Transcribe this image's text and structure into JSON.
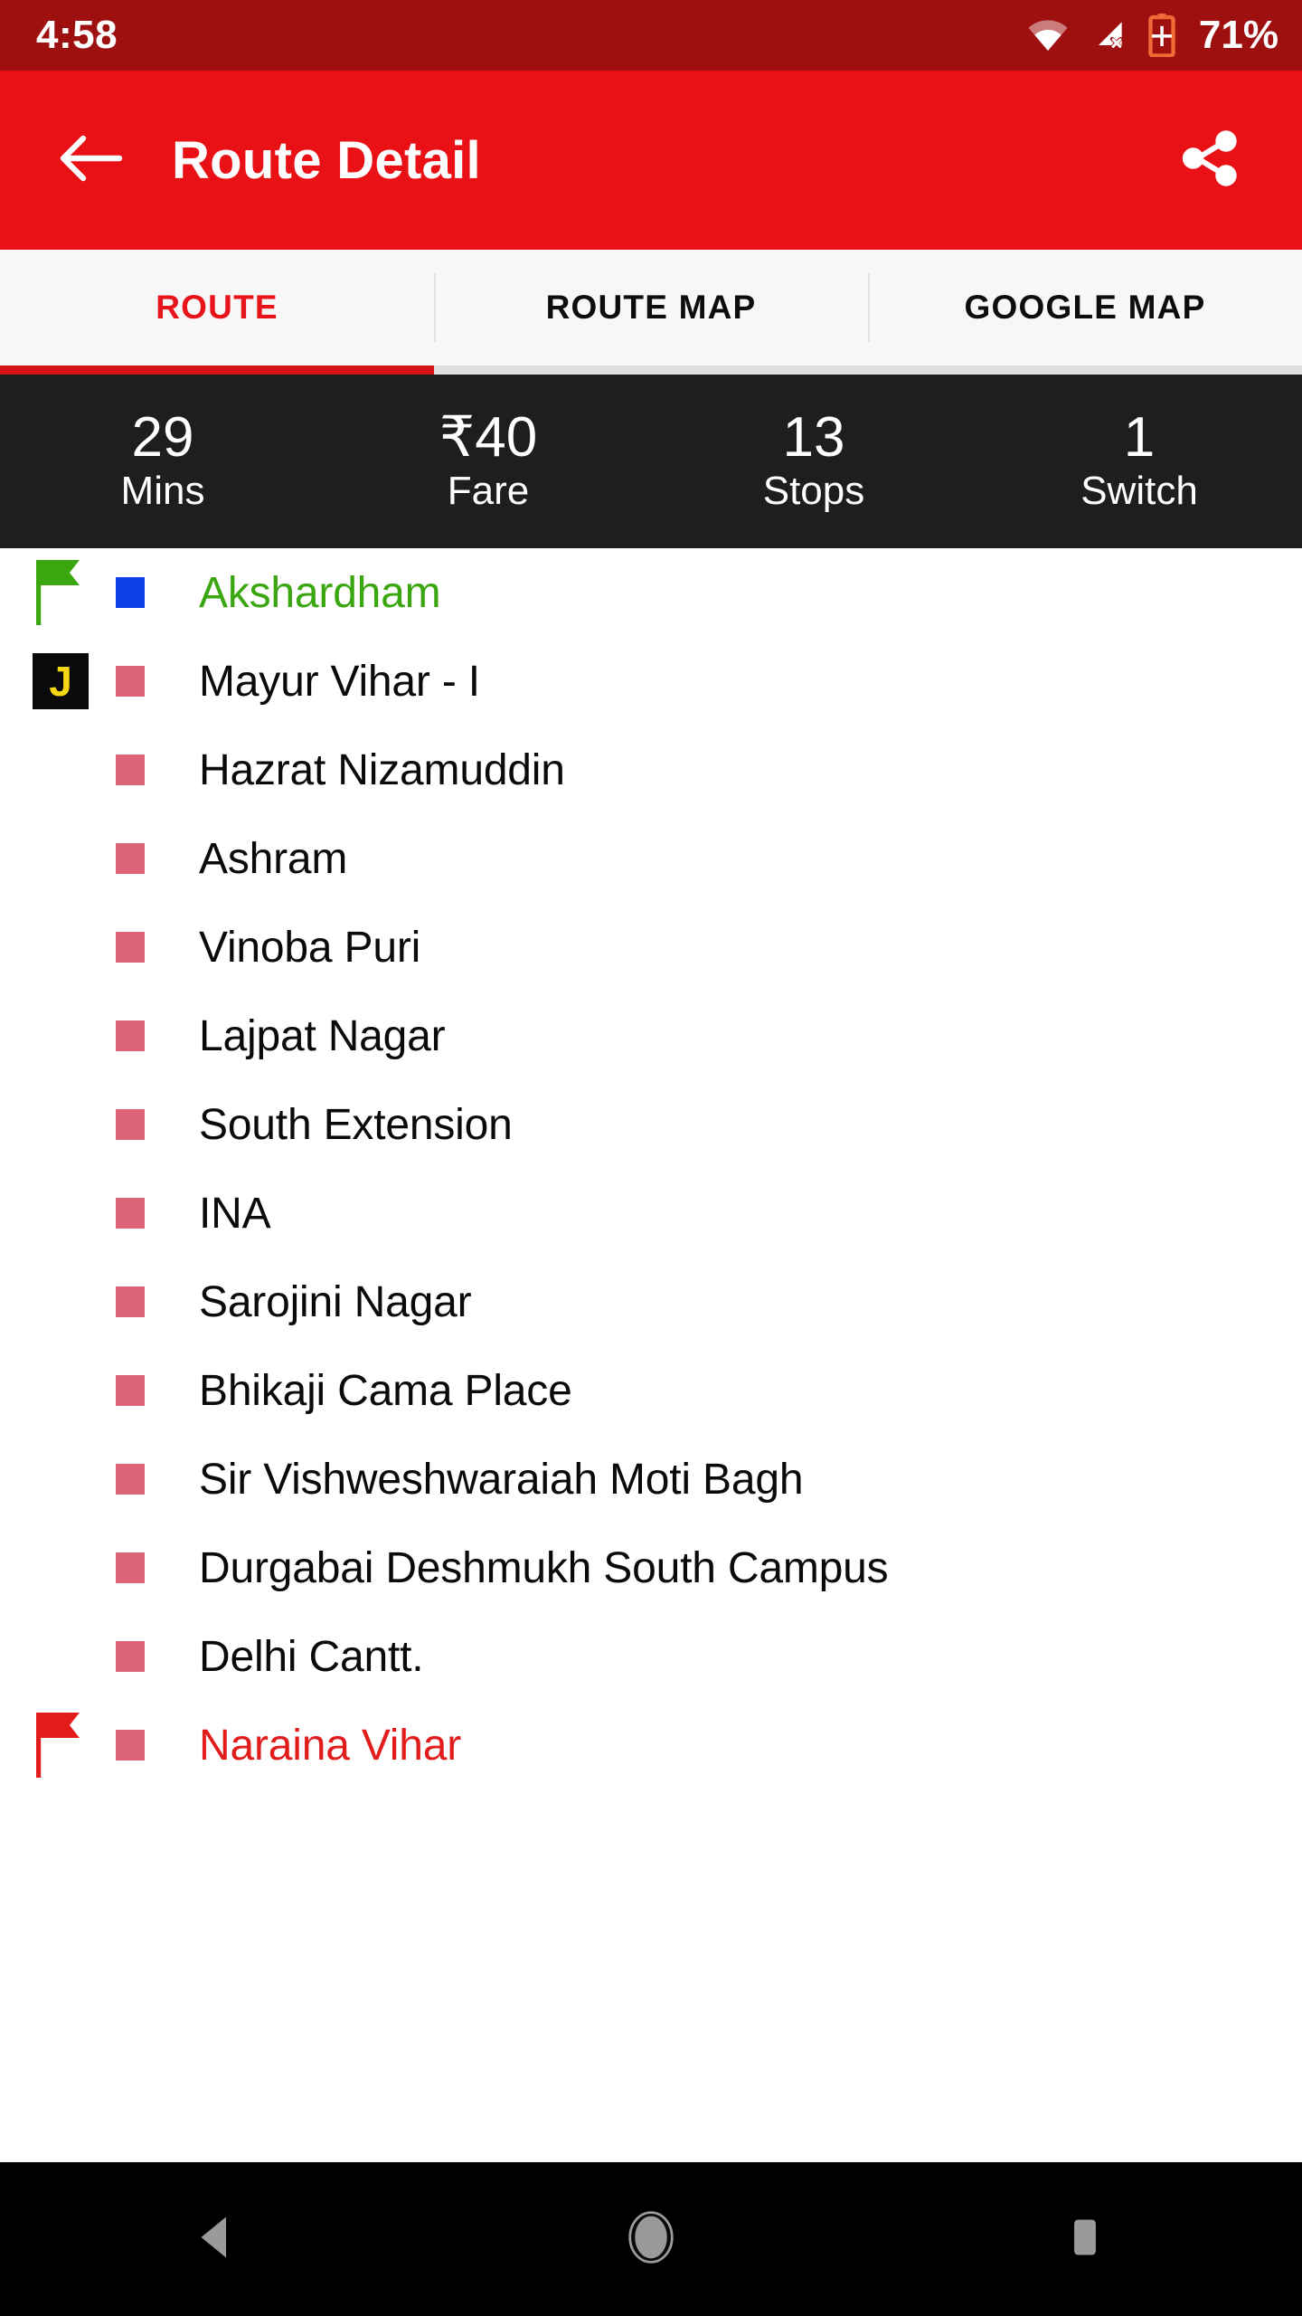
{
  "status_bar": {
    "time": "4:58",
    "battery_percent": "71%",
    "icons": [
      "wifi-icon",
      "cellular-no-sim-icon",
      "battery-charging-icon"
    ],
    "background_color": "#9E1010"
  },
  "app_bar": {
    "back_label": "back-arrow",
    "title": "Route Detail",
    "share_label": "share",
    "background_color": "#EA1116"
  },
  "tabs": {
    "active_index": 0,
    "items": [
      {
        "label": "ROUTE"
      },
      {
        "label": "ROUTE MAP"
      },
      {
        "label": "GOOGLE MAP"
      }
    ],
    "active_color": "#E8141B",
    "inactive_color": "#0D0D0D",
    "indicator_color": "#D7131A"
  },
  "stats": {
    "background_color": "#1E1E1E",
    "items": [
      {
        "value": "29",
        "label": "Mins"
      },
      {
        "value": "₹40",
        "label": "Fare"
      },
      {
        "value": "13",
        "label": "Stops"
      },
      {
        "value": "1",
        "label": "Switch"
      }
    ]
  },
  "colors": {
    "start_green": "#3AA610",
    "end_red": "#E21B1B",
    "marker_blue": "#0B3FE8",
    "marker_pink": "#DD6378",
    "junction_bg": "#0A0A0A",
    "junction_text": "#F5D613"
  },
  "stops": [
    {
      "name": "Akshardham",
      "flag": "start-flag-icon",
      "marker": "#0B3FE8",
      "text_color": "#3AA610",
      "junction": ""
    },
    {
      "name": "Mayur Vihar - I",
      "flag": "",
      "marker": "#DD6378",
      "text_color": "#0A0A0A",
      "junction": "J"
    },
    {
      "name": "Hazrat Nizamuddin",
      "flag": "",
      "marker": "#DD6378",
      "text_color": "#0A0A0A",
      "junction": ""
    },
    {
      "name": "Ashram",
      "flag": "",
      "marker": "#DD6378",
      "text_color": "#0A0A0A",
      "junction": ""
    },
    {
      "name": "Vinoba Puri",
      "flag": "",
      "marker": "#DD6378",
      "text_color": "#0A0A0A",
      "junction": ""
    },
    {
      "name": "Lajpat Nagar",
      "flag": "",
      "marker": "#DD6378",
      "text_color": "#0A0A0A",
      "junction": ""
    },
    {
      "name": "South Extension",
      "flag": "",
      "marker": "#DD6378",
      "text_color": "#0A0A0A",
      "junction": ""
    },
    {
      "name": "INA",
      "flag": "",
      "marker": "#DD6378",
      "text_color": "#0A0A0A",
      "junction": ""
    },
    {
      "name": "Sarojini Nagar",
      "flag": "",
      "marker": "#DD6378",
      "text_color": "#0A0A0A",
      "junction": ""
    },
    {
      "name": "Bhikaji Cama Place",
      "flag": "",
      "marker": "#DD6378",
      "text_color": "#0A0A0A",
      "junction": ""
    },
    {
      "name": "Sir Vishweshwaraiah Moti Bagh",
      "flag": "",
      "marker": "#DD6378",
      "text_color": "#0A0A0A",
      "junction": ""
    },
    {
      "name": "Durgabai Deshmukh South Campus",
      "flag": "",
      "marker": "#DD6378",
      "text_color": "#0A0A0A",
      "junction": ""
    },
    {
      "name": "Delhi Cantt.",
      "flag": "",
      "marker": "#DD6378",
      "text_color": "#0A0A0A",
      "junction": ""
    },
    {
      "name": "Naraina Vihar",
      "flag": "end-flag-icon",
      "marker": "#DD6378",
      "text_color": "#E21B1B",
      "junction": ""
    }
  ],
  "nav_bar": {
    "items": [
      "back-triangle-icon",
      "home-circle-icon",
      "recents-square-icon"
    ]
  }
}
